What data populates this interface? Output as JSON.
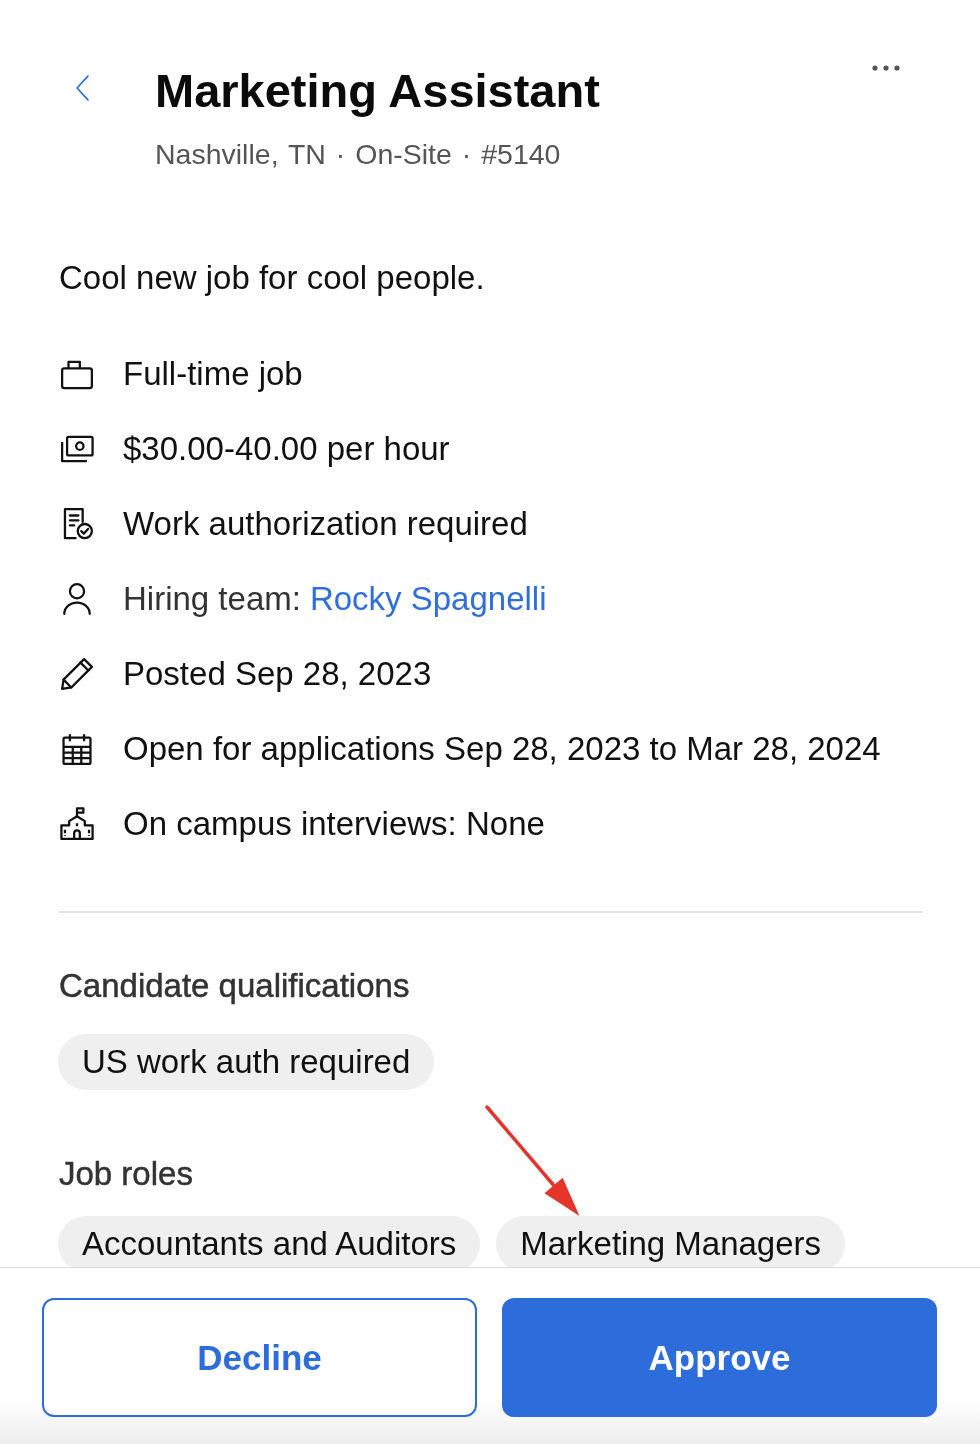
{
  "header": {
    "title": "Marketing Assistant",
    "meta": "Nashville, TN · On-Site · #5140"
  },
  "description": "Cool new job for cool people.",
  "details": [
    {
      "kind": "job_type",
      "text": "Full-time job"
    },
    {
      "kind": "pay",
      "text": "$30.00-40.00 per hour"
    },
    {
      "kind": "authorization",
      "text": "Work authorization required"
    },
    {
      "kind": "hiring_team",
      "text": "Hiring team:",
      "link": "Rocky Spagnelli"
    },
    {
      "kind": "posted",
      "text": "Posted Sep 28, 2023"
    },
    {
      "kind": "open_dates",
      "text": "Open for applications Sep 28, 2023 to Mar 28, 2024"
    },
    {
      "kind": "interviews",
      "text": "On campus interviews: None"
    }
  ],
  "sections": [
    {
      "title": "Candidate qualifications",
      "tags": [
        "US work auth required"
      ]
    },
    {
      "title": "Job roles",
      "tags": [
        "Accountants and Auditors",
        "Marketing Managers"
      ]
    }
  ],
  "actions": [
    {
      "kind": "secondary",
      "label": "Decline"
    },
    {
      "kind": "primary",
      "label": "Approve"
    }
  ]
}
